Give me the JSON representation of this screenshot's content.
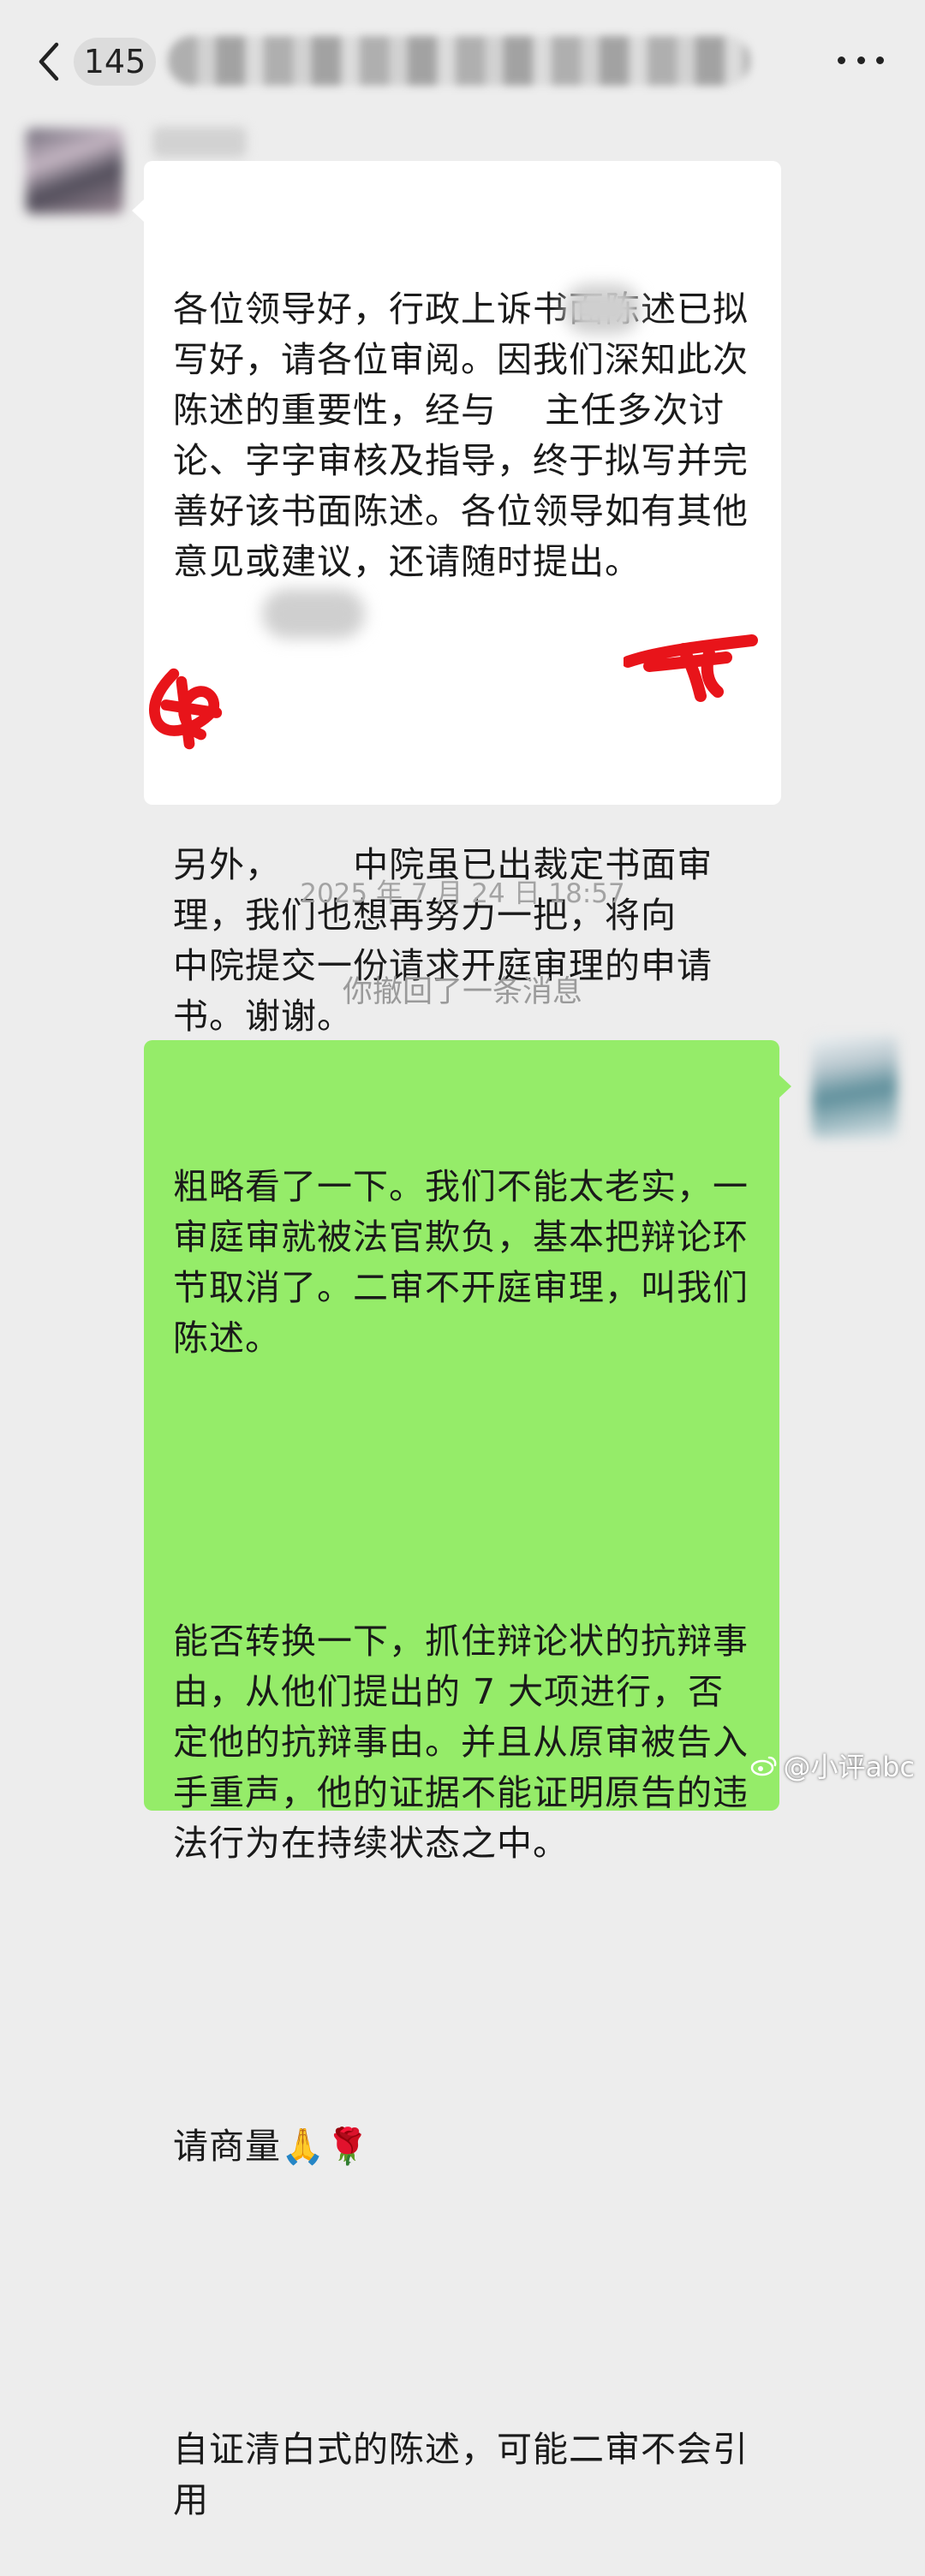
{
  "header": {
    "unread_count": "145",
    "title": "",
    "back_icon": "chevron-left-icon",
    "more_icon": "more-dots-icon"
  },
  "messages": [
    {
      "side": "incoming",
      "paragraphs": [
        "各位领导好，行政上诉书面陈述已拟写好，请各位审阅。因我们深知此次陈述的重要性，经与    主任多次讨论、字字审核及指导，终于拟写并完善好该书面陈述。各位领导如有其他意见或建议，还请随时提出。",
        "另外，      中院虽已出裁定书面审理，我们也想再努力一把，将向    中院提交一份请求开庭审理的申请书。谢谢。"
      ]
    },
    {
      "side": "outgoing",
      "paragraphs": [
        "粗略看了一下。我们不能太老实，一审庭审就被法官欺负，基本把辩论环节取消了。二审不开庭审理，叫我们陈述。",
        "能否转换一下，抓住辩论状的抗辩事由，从他们提出的 7 大项进行，否定他的抗辩事由。并且从原审被告入手重声，他的证据不能证明原告的违法行为在持续状态之中。",
        "请商量🙏🌹",
        "自证清白式的陈述，可能二审不会引用"
      ]
    }
  ],
  "timestamp": "2025 年 7 月 24 日 18:57",
  "system_notice": "你撤回了一条消息",
  "watermark": "@小评abc",
  "colors": {
    "background": "#ededed",
    "incoming_bubble": "#ffffff",
    "outgoing_bubble": "#95ec69",
    "annotation_red": "#e8141a"
  }
}
